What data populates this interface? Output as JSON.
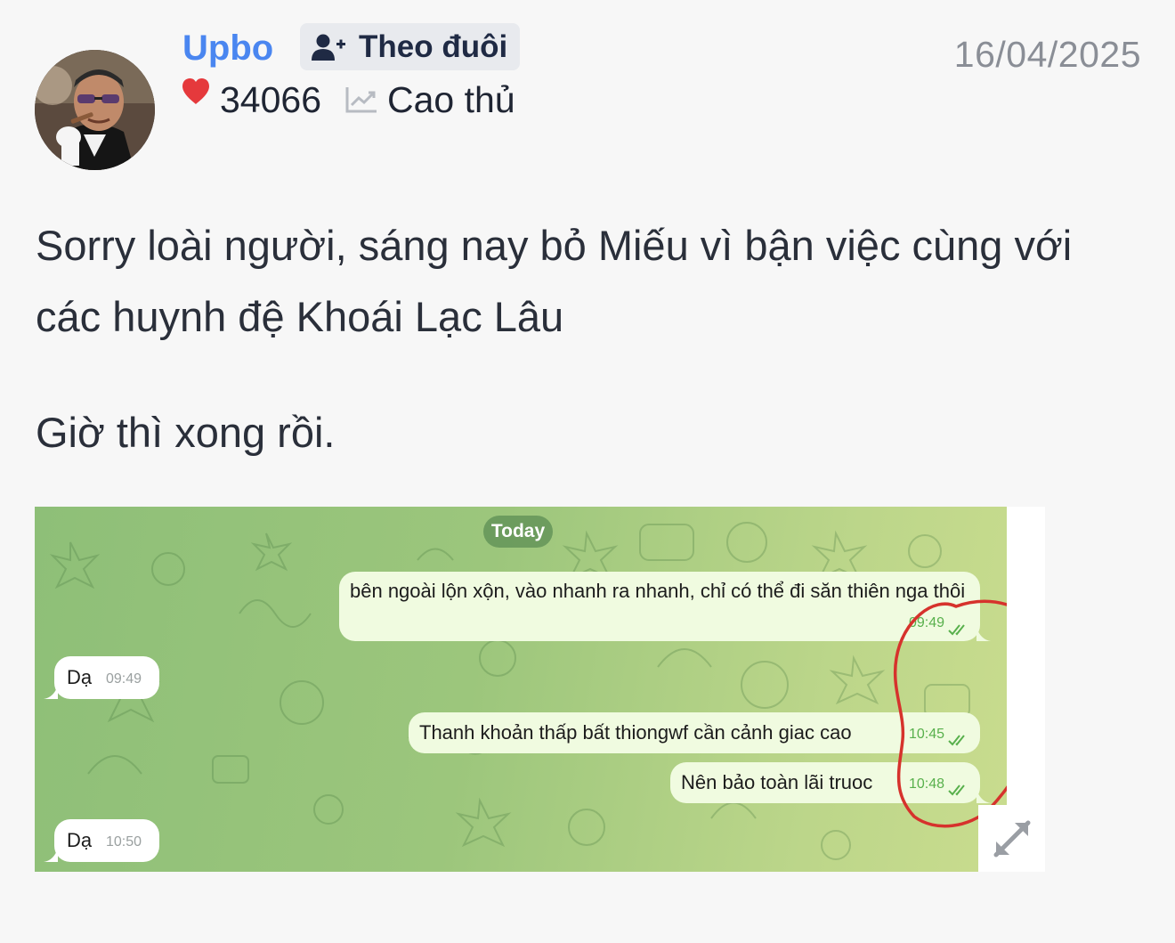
{
  "author": {
    "name": "Upbo",
    "avatar_icon": "user-avatar-photo",
    "follow_label": "Theo đuôi",
    "follow_icon": "user-plus-icon",
    "score": "34066",
    "score_icon": "heart-icon",
    "rank": "Cao thủ",
    "rank_icon": "trend-chart-icon"
  },
  "post": {
    "date": "16/04/2025",
    "paragraphs": [
      "Sorry loài người, sáng nay bỏ Miếu vì bận việc cùng với các huynh đệ Khoái Lạc Lâu",
      "Giờ thì xong rồi."
    ]
  },
  "attachment": {
    "date_pill": "Today",
    "messages": [
      {
        "direction": "out",
        "text": "bên ngoài lộn xộn, vào nhanh ra nhanh, chỉ có thể đi săn thiên nga thôi",
        "time": "09:49"
      },
      {
        "direction": "in",
        "text": "Dạ",
        "time": "09:49"
      },
      {
        "direction": "out",
        "text": "Thanh khoản thấp bất thiongwf cần cảnh giac cao",
        "time": "10:45"
      },
      {
        "direction": "out",
        "text": "Nên bảo toàn lãi truoc",
        "time": "10:48"
      },
      {
        "direction": "in",
        "text": "Dạ",
        "time": "10:50"
      }
    ],
    "expand_icon": "expand-icon",
    "colors": {
      "chat_bg_start": "#8ebf78",
      "chat_bg_end": "#c9dc8e",
      "outgoing_bubble": "#f0fbe0",
      "incoming_bubble": "#ffffff",
      "annotation_circle": "#d6322c"
    }
  },
  "colors": {
    "username": "#4a86f0",
    "heart": "#e5393c",
    "date": "#8a8e96",
    "background": "#f7f7f7"
  }
}
